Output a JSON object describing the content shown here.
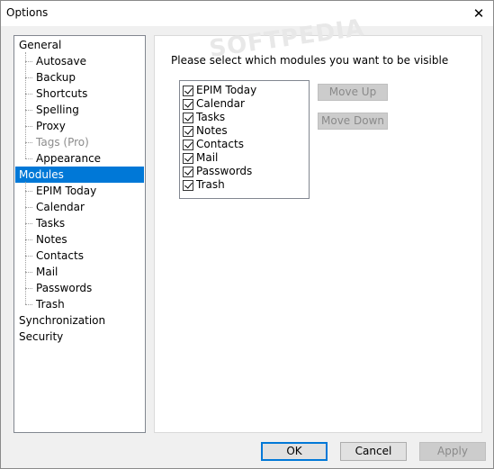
{
  "window": {
    "title": "Options",
    "close_glyph": "✕"
  },
  "tree": {
    "items": [
      {
        "label": "General",
        "level": 0,
        "selected": false,
        "disabled": false
      },
      {
        "label": "Autosave",
        "level": 1,
        "selected": false,
        "disabled": false
      },
      {
        "label": "Backup",
        "level": 1,
        "selected": false,
        "disabled": false
      },
      {
        "label": "Shortcuts",
        "level": 1,
        "selected": false,
        "disabled": false
      },
      {
        "label": "Spelling",
        "level": 1,
        "selected": false,
        "disabled": false
      },
      {
        "label": "Proxy",
        "level": 1,
        "selected": false,
        "disabled": false
      },
      {
        "label": "Tags (Pro)",
        "level": 1,
        "selected": false,
        "disabled": true
      },
      {
        "label": "Appearance",
        "level": 1,
        "selected": false,
        "disabled": false
      },
      {
        "label": "Modules",
        "level": 0,
        "selected": true,
        "disabled": false
      },
      {
        "label": "EPIM Today",
        "level": 1,
        "selected": false,
        "disabled": false
      },
      {
        "label": "Calendar",
        "level": 1,
        "selected": false,
        "disabled": false
      },
      {
        "label": "Tasks",
        "level": 1,
        "selected": false,
        "disabled": false
      },
      {
        "label": "Notes",
        "level": 1,
        "selected": false,
        "disabled": false
      },
      {
        "label": "Contacts",
        "level": 1,
        "selected": false,
        "disabled": false
      },
      {
        "label": "Mail",
        "level": 1,
        "selected": false,
        "disabled": false
      },
      {
        "label": "Passwords",
        "level": 1,
        "selected": false,
        "disabled": false
      },
      {
        "label": "Trash",
        "level": 1,
        "selected": false,
        "disabled": false
      },
      {
        "label": "Synchronization",
        "level": 0,
        "selected": false,
        "disabled": false
      },
      {
        "label": "Security",
        "level": 0,
        "selected": false,
        "disabled": false
      }
    ]
  },
  "modules_panel": {
    "instruction": "Please select which modules you want to be visible",
    "watermark": "SOFTPEDIA",
    "modules": [
      {
        "label": "EPIM Today",
        "checked": true
      },
      {
        "label": "Calendar",
        "checked": true
      },
      {
        "label": "Tasks",
        "checked": true
      },
      {
        "label": "Notes",
        "checked": true
      },
      {
        "label": "Contacts",
        "checked": true
      },
      {
        "label": "Mail",
        "checked": true
      },
      {
        "label": "Passwords",
        "checked": true
      },
      {
        "label": "Trash",
        "checked": true
      }
    ],
    "move_up_label": "Move Up",
    "move_down_label": "Move Down"
  },
  "footer": {
    "ok_label": "OK",
    "cancel_label": "Cancel",
    "apply_label": "Apply"
  },
  "colors": {
    "selection": "#0078d7",
    "disabled_text": "#8a8a8a"
  }
}
